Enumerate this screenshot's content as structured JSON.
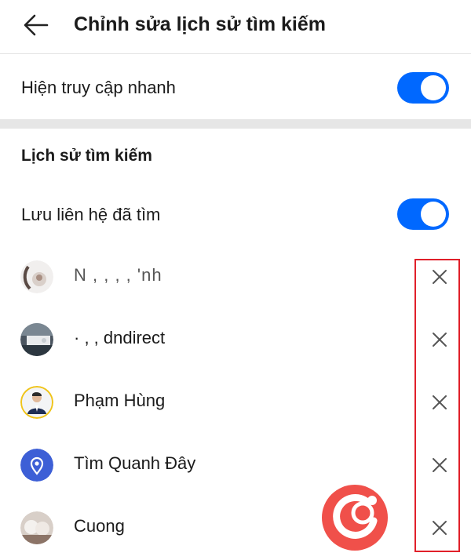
{
  "header": {
    "title": "Chỉnh sửa lịch sử tìm kiếm",
    "back_icon": "arrow-left-icon"
  },
  "quick_access": {
    "label": "Hiện truy cập nhanh",
    "enabled": true
  },
  "history_section": {
    "title": "Lịch sử tìm kiếm",
    "save_contacts": {
      "label": "Lưu liên hệ đã tìm",
      "enabled": true
    },
    "items": [
      {
        "name": "N   ,     ,  ,   ,   'nh",
        "avatar": "photo"
      },
      {
        "name": "·   ,   ,   dndirect",
        "avatar": "photo"
      },
      {
        "name": "Phạm Hùng",
        "avatar": "photo"
      },
      {
        "name": "Tìm Quanh Đây",
        "avatar": "location-pin-icon"
      },
      {
        "name": "Cuong",
        "avatar": "photo"
      }
    ],
    "remove_icon": "close-icon"
  },
  "colors": {
    "accent": "#0068ff",
    "highlight": "#e0202a",
    "logo": "#f0504a"
  }
}
